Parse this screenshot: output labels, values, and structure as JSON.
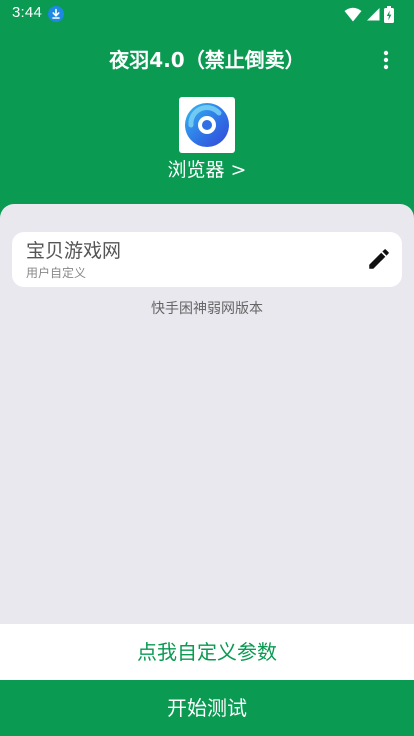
{
  "status_bar": {
    "time": "3:44",
    "icons": [
      "download-icon",
      "wifi-icon",
      "signal-icon",
      "battery-charging-icon"
    ]
  },
  "header": {
    "title": "夜羽4.0（禁止倒卖）",
    "menu_icon": "more-vert-icon"
  },
  "browser": {
    "icon": "browser-icon",
    "label": "浏览器 >"
  },
  "card": {
    "title": "宝贝游戏网",
    "subtitle": "用户自定义",
    "edit_icon": "edit-pencil-icon"
  },
  "version_text": "快手困神弱网版本",
  "buttons": {
    "custom_params": "点我自定义参数",
    "start_test": "开始测试"
  },
  "colors": {
    "primary_green": "#0a9a52",
    "panel_bg": "#e8e8ee",
    "card_bg": "#ffffff",
    "download_badge": "#1e88e5"
  }
}
